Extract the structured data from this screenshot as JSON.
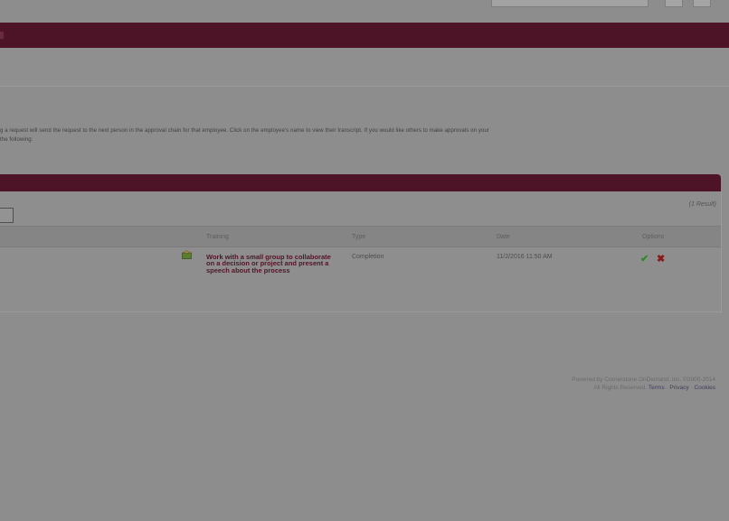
{
  "header": {
    "search_placeholder": ""
  },
  "description": {
    "line1": "g a request will send the request to the next person in the approval chain for that employee. Click on the employee's name to view their transcript. If you would like others to make approvals on your",
    "line2": "the following:"
  },
  "table": {
    "result_count": "(1 Result)",
    "columns": {
      "training": "Training",
      "type": "Type",
      "date": "Date",
      "options": "Options"
    },
    "rows": [
      {
        "training": "Work with a small group to collaborate on a decision or project and present a speech about the process",
        "type": "Completion",
        "date": "11/2/2016 11:50 AM"
      }
    ],
    "icons": {
      "approve": "checkmark-icon",
      "reject": "x-icon",
      "training_type": "document-icon"
    }
  },
  "footer": {
    "powered_by": "Powered by Cornerstone OnDemand, Inc. ©2000-2014",
    "rights": "All Rights Reserved.",
    "links": [
      "Terms",
      "Privacy",
      "Cookies"
    ]
  },
  "colors": {
    "banner": "#4c1426",
    "approve": "#2e8a2a",
    "reject": "#8a1818"
  }
}
